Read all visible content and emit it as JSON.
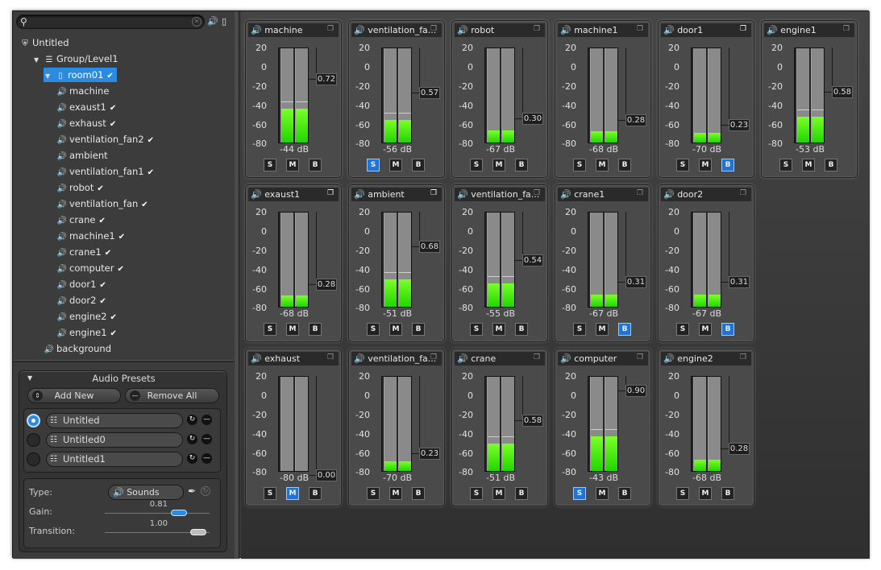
{
  "search": {
    "placeholder": ""
  },
  "tree": {
    "root": "Untitled",
    "group": "Group/Level1",
    "room": "room01",
    "items": [
      {
        "label": "machine",
        "checked": false
      },
      {
        "label": "exaust1",
        "checked": true
      },
      {
        "label": "exhaust",
        "checked": true
      },
      {
        "label": "ventilation_fan2",
        "checked": true
      },
      {
        "label": "ambient",
        "checked": false
      },
      {
        "label": "ventilation_fan1",
        "checked": true
      },
      {
        "label": "robot",
        "checked": true
      },
      {
        "label": "ventilation_fan",
        "checked": true
      },
      {
        "label": "crane",
        "checked": true
      },
      {
        "label": "machine1",
        "checked": true
      },
      {
        "label": "crane1",
        "checked": true
      },
      {
        "label": "computer",
        "checked": true
      },
      {
        "label": "door1",
        "checked": true
      },
      {
        "label": "door2",
        "checked": true
      },
      {
        "label": "engine2",
        "checked": true
      },
      {
        "label": "engine1",
        "checked": true
      }
    ],
    "background": "background"
  },
  "presets": {
    "title": "Audio Presets",
    "add_new": "Add New",
    "remove_all": "Remove All",
    "list": [
      {
        "name": "Untitled",
        "selected": true
      },
      {
        "name": "Untitled0",
        "selected": false
      },
      {
        "name": "Untitled1",
        "selected": false
      }
    ],
    "type_label": "Type:",
    "type_value": "Sounds",
    "gain_label": "Gain:",
    "gain_value": "0.81",
    "gain_fraction": 0.81,
    "transition_label": "Transition:",
    "transition_value": "1.00",
    "transition_fraction": 1.0
  },
  "ticks": [
    "20",
    "0",
    "-20",
    "-40",
    "-60",
    "-80"
  ],
  "buttons": {
    "solo": "S",
    "mute": "M",
    "bypass": "B"
  },
  "colors": {
    "meter_green": "#3bf000",
    "accent_blue": "#2b8be0"
  },
  "mixers": [
    [
      {
        "name": "machine",
        "db": "-44 dB",
        "db_value": -44,
        "gain": "0.72",
        "gain_value": 0.72,
        "solo": false,
        "mute": false,
        "bypass": false,
        "copy": false
      },
      {
        "name": "ventilation_fa...",
        "db": "-56 dB",
        "db_value": -56,
        "gain": "0.57",
        "gain_value": 0.57,
        "solo": true,
        "mute": false,
        "bypass": false,
        "copy": false
      },
      {
        "name": "robot",
        "db": "-67 dB",
        "db_value": -67,
        "gain": "0.30",
        "gain_value": 0.3,
        "solo": false,
        "mute": false,
        "bypass": false,
        "copy": false
      },
      {
        "name": "machine1",
        "db": "-68 dB",
        "db_value": -68,
        "gain": "0.28",
        "gain_value": 0.28,
        "solo": false,
        "mute": false,
        "bypass": false,
        "copy": false
      },
      {
        "name": "door1",
        "db": "-70 dB",
        "db_value": -70,
        "gain": "0.23",
        "gain_value": 0.23,
        "solo": false,
        "mute": false,
        "bypass": true,
        "copy": true
      },
      {
        "name": "engine1",
        "db": "-53 dB",
        "db_value": -53,
        "gain": "0.58",
        "gain_value": 0.58,
        "solo": false,
        "mute": false,
        "bypass": false,
        "copy": false
      }
    ],
    [
      {
        "name": "exaust1",
        "db": "-68 dB",
        "db_value": -68,
        "gain": "0.28",
        "gain_value": 0.28,
        "solo": false,
        "mute": false,
        "bypass": false,
        "copy": true
      },
      {
        "name": "ambient",
        "db": "-51 dB",
        "db_value": -51,
        "gain": "0.68",
        "gain_value": 0.68,
        "solo": false,
        "mute": false,
        "bypass": false,
        "copy": true
      },
      {
        "name": "ventilation_fa...",
        "db": "-55 dB",
        "db_value": -55,
        "gain": "0.54",
        "gain_value": 0.54,
        "solo": false,
        "mute": false,
        "bypass": false,
        "copy": false
      },
      {
        "name": "crane1",
        "db": "-67 dB",
        "db_value": -67,
        "gain": "0.31",
        "gain_value": 0.31,
        "solo": false,
        "mute": false,
        "bypass": true,
        "copy": false
      },
      {
        "name": "door2",
        "db": "-67 dB",
        "db_value": -67,
        "gain": "0.31",
        "gain_value": 0.31,
        "solo": false,
        "mute": false,
        "bypass": true,
        "copy": false
      }
    ],
    [
      {
        "name": "exhaust",
        "db": "-80 dB",
        "db_value": -80,
        "gain": "0.00",
        "gain_value": 0.0,
        "solo": false,
        "mute": true,
        "bypass": false,
        "copy": false
      },
      {
        "name": "ventilation_fa...",
        "db": "-70 dB",
        "db_value": -70,
        "gain": "0.23",
        "gain_value": 0.23,
        "solo": false,
        "mute": false,
        "bypass": false,
        "copy": false
      },
      {
        "name": "crane",
        "db": "-51 dB",
        "db_value": -51,
        "gain": "0.58",
        "gain_value": 0.58,
        "solo": false,
        "mute": false,
        "bypass": false,
        "copy": false
      },
      {
        "name": "computer",
        "db": "-43 dB",
        "db_value": -43,
        "gain": "0.90",
        "gain_value": 0.9,
        "solo": true,
        "mute": false,
        "bypass": false,
        "copy": false
      },
      {
        "name": "engine2",
        "db": "-68 dB",
        "db_value": -68,
        "gain": "0.28",
        "gain_value": 0.28,
        "solo": false,
        "mute": false,
        "bypass": false,
        "copy": false
      }
    ]
  ]
}
